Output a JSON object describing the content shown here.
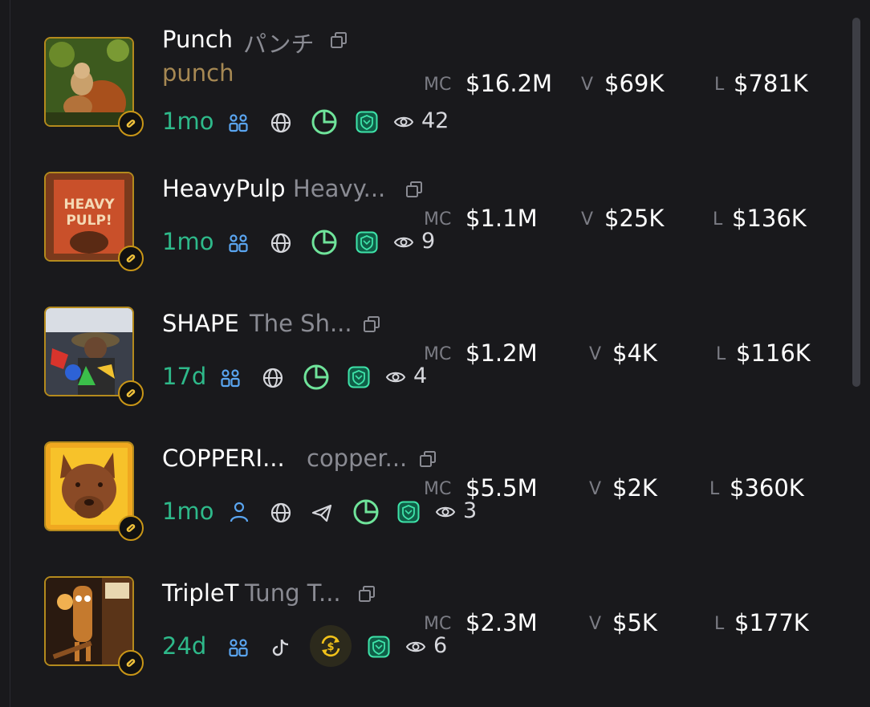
{
  "tokens": [
    {
      "ticker": "Punch",
      "name": "パンチ",
      "subname": "punch",
      "age": "1mo",
      "holder_icon": "group-icon",
      "social_icons": [
        "globe-icon",
        "pie-chart-icon",
        "shield-icon"
      ],
      "views": "42",
      "mc_label": "MC",
      "mc": "$16.2M",
      "v_label": "V",
      "v": "$69K",
      "l_label": "L",
      "l": "$781K"
    },
    {
      "ticker": "HeavyPulp",
      "name": "Heavy...",
      "age": "1mo",
      "holder_icon": "group-icon",
      "social_icons": [
        "globe-icon",
        "pie-chart-icon",
        "shield-icon"
      ],
      "views": "9",
      "mc_label": "MC",
      "mc": "$1.1M",
      "v_label": "V",
      "v": "$25K",
      "l_label": "L",
      "l": "$136K"
    },
    {
      "ticker": "SHAPE",
      "name": "The Sh...",
      "age": "17d",
      "holder_icon": "group-icon",
      "social_icons": [
        "globe-icon",
        "pie-chart-icon",
        "shield-icon"
      ],
      "views": "4",
      "mc_label": "MC",
      "mc": "$1.2M",
      "v_label": "V",
      "v": "$4K",
      "l_label": "L",
      "l": "$116K"
    },
    {
      "ticker": "COPPERI...",
      "name": "copper...",
      "age": "1mo",
      "holder_icon": "user-icon",
      "social_icons": [
        "globe-icon",
        "telegram-icon",
        "pie-chart-icon",
        "shield-icon"
      ],
      "views": "3",
      "mc_label": "MC",
      "mc": "$5.5M",
      "v_label": "V",
      "v": "$2K",
      "l_label": "L",
      "l": "$360K"
    },
    {
      "ticker": "TripleT",
      "name": "Tung T...",
      "age": "24d",
      "holder_icon": "group-icon",
      "social_icons": [
        "tiktok-icon",
        "dollar-swap-icon",
        "shield-icon"
      ],
      "views": "6",
      "mc_label": "MC",
      "mc": "$2.3M",
      "v_label": "V",
      "v": "$5K",
      "l_label": "L",
      "l": "$177K"
    }
  ],
  "colors": {
    "background": "#19191c",
    "age_green": "#2eb98a",
    "accent_blue": "#5aa5f0",
    "pie_green": "#6fe39a",
    "badge_gold": "#c99617",
    "muted_text": "#8a8b93"
  }
}
